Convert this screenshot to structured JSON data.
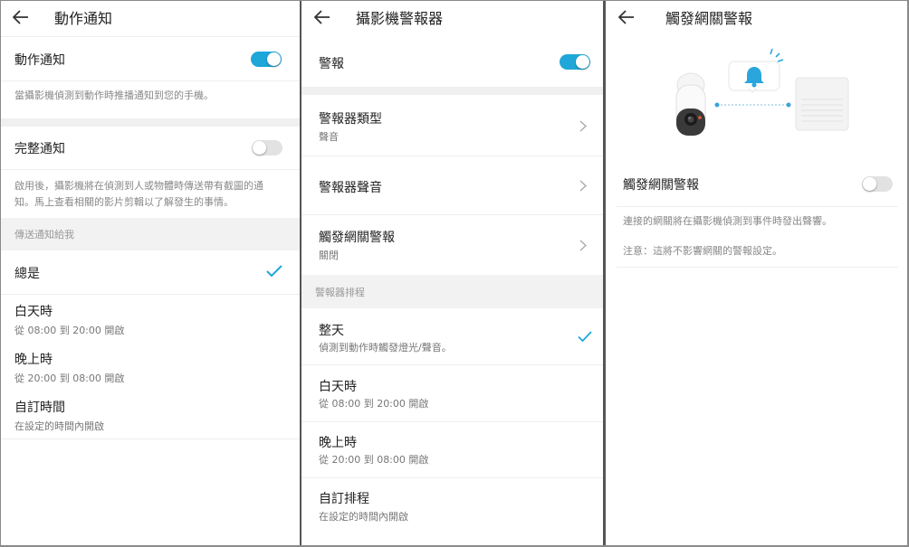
{
  "panel1": {
    "title": "動作通知",
    "motion_notification": {
      "label": "動作通知",
      "enabled": true,
      "description": "當攝影機偵測到動作時推播通知到您的手機。"
    },
    "full_notification": {
      "label": "完整通知",
      "enabled": false,
      "description_line1": "啟用後，攝影機將在偵測到人或物體時傳送帶有截圖的通",
      "description_line2": "知。馬上查看相關的影片剪輯以了解發生的事情。"
    },
    "send_section_header": "傳送通知給我",
    "schedule_options": [
      {
        "label": "總是",
        "sub": "",
        "selected": true
      },
      {
        "label": "白天時",
        "sub": "從 08:00 到 20:00 開啟",
        "selected": false
      },
      {
        "label": "晚上時",
        "sub": "從 20:00 到 08:00 開啟",
        "selected": false
      },
      {
        "label": "自訂時間",
        "sub": "在設定的時間內開啟",
        "selected": false
      }
    ]
  },
  "panel2": {
    "title": "攝影機警報器",
    "alarm": {
      "label": "警報",
      "enabled": true
    },
    "settings": [
      {
        "label": "警報器類型",
        "value": "聲音"
      },
      {
        "label": "警報器聲音",
        "value": ""
      },
      {
        "label": "觸發網關警報",
        "value": "關閉"
      }
    ],
    "schedule_section_header": "警報器排程",
    "schedule_options": [
      {
        "label": "整天",
        "sub": "偵測到動作時觸發燈光/聲音。",
        "selected": true
      },
      {
        "label": "白天時",
        "sub": "從 08:00 到 20:00 開啟",
        "selected": false
      },
      {
        "label": "晚上時",
        "sub": "從 20:00 到 08:00 開啟",
        "selected": false
      },
      {
        "label": "自訂排程",
        "sub": "在設定的時間內開啟",
        "selected": false
      }
    ]
  },
  "panel3": {
    "title": "觸發網關警報",
    "hub_alarm": {
      "label": "觸發網關警報",
      "enabled": false
    },
    "description": "連接的網關將在攝影機偵測到事件時發出聲響。",
    "note": "注意：這將不影響網關的警報設定。"
  },
  "colors": {
    "accent": "#1ea7d8",
    "toggle_off": "#e2e2e2",
    "section_bg": "#f2f2f2"
  },
  "icons": [
    "back-arrow-icon",
    "checkmark-icon",
    "chevron-right-icon",
    "camera-illustration",
    "bell-icon",
    "hub-device-illustration"
  ]
}
